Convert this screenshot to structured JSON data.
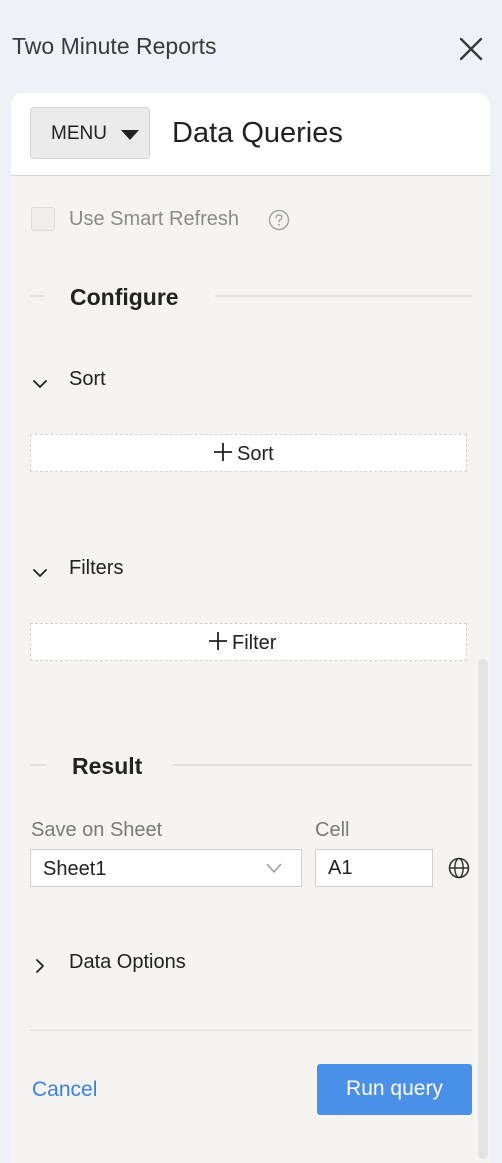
{
  "header": {
    "title": "Two Minute Reports",
    "close_icon": "close-icon"
  },
  "toolbar": {
    "menu_label": "MENU",
    "page_title": "Data Queries"
  },
  "smart_refresh": {
    "label": "Use Smart Refresh",
    "checked": false,
    "help_icon": "question-circle-icon"
  },
  "configure": {
    "title": "Configure",
    "sort": {
      "label": "Sort",
      "add_label": "Sort",
      "expanded": true
    },
    "filters": {
      "label": "Filters",
      "add_label": "Filter",
      "expanded": true
    }
  },
  "result": {
    "title": "Result",
    "sheet_label": "Save on Sheet",
    "sheet_value": "Sheet1",
    "cell_label": "Cell",
    "cell_value": "A1",
    "data_options_label": "Data Options"
  },
  "footer": {
    "cancel_label": "Cancel",
    "run_label": "Run query"
  },
  "colors": {
    "accent": "#4a90e9",
    "link": "#3b82e0",
    "panel": "#f5f4f1",
    "page": "#eef2f8"
  }
}
